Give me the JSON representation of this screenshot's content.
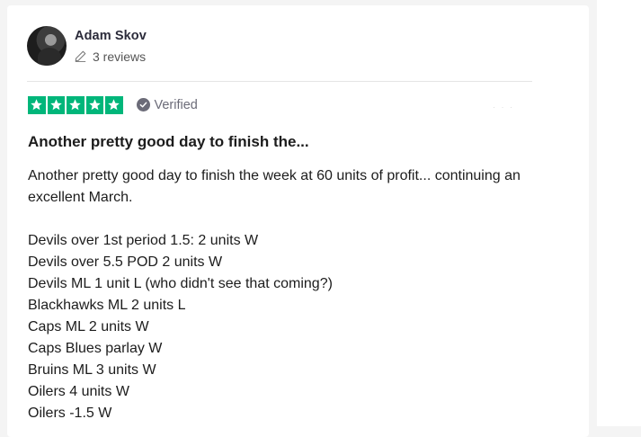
{
  "reviewer": {
    "name": "Adam Skov",
    "reviews_count": "3 reviews"
  },
  "rating": {
    "stars": 5,
    "max_stars": 5,
    "star_color": "#00b67a",
    "verified_label": "Verified"
  },
  "review": {
    "title": "Another pretty good day to finish the...",
    "intro": "Another pretty good day to finish the week at 60 units of profit... continuing an excellent March.",
    "lines": [
      "Devils over 1st period 1.5: 2 units W",
      "Devils over 5.5 POD 2 units W",
      "Devils ML 1 unit L (who didn't see that coming?)",
      "Blackhawks ML 2 units L",
      "Caps ML 2 units W",
      "Caps Blues parlay W",
      "Bruins ML 3 units W",
      "Oilers 4 units W",
      "Oilers -1.5 W"
    ]
  }
}
